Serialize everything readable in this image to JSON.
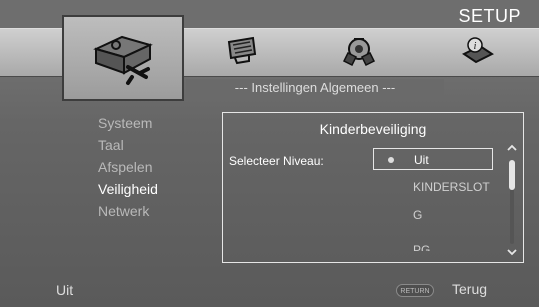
{
  "header": {
    "title": "SETUP"
  },
  "icons": [
    "toolbox-icon",
    "display-icon",
    "speaker-icon",
    "info-icon"
  ],
  "subheader": "--- Instellingen Algemeen ---",
  "menu": {
    "items": [
      "Systeem",
      "Taal",
      "Afspelen",
      "Veiligheid",
      "Netwerk"
    ],
    "active_index": 3
  },
  "panel": {
    "title": "Kinderbeveiliging",
    "level_label": "Selecteer Niveau:",
    "options": [
      "Uit",
      "KINDERSLOT",
      "G",
      "PG"
    ],
    "selected_index": 0
  },
  "footer": {
    "status": "Uit",
    "return_button": "RETURN",
    "return_label": "Terug"
  }
}
